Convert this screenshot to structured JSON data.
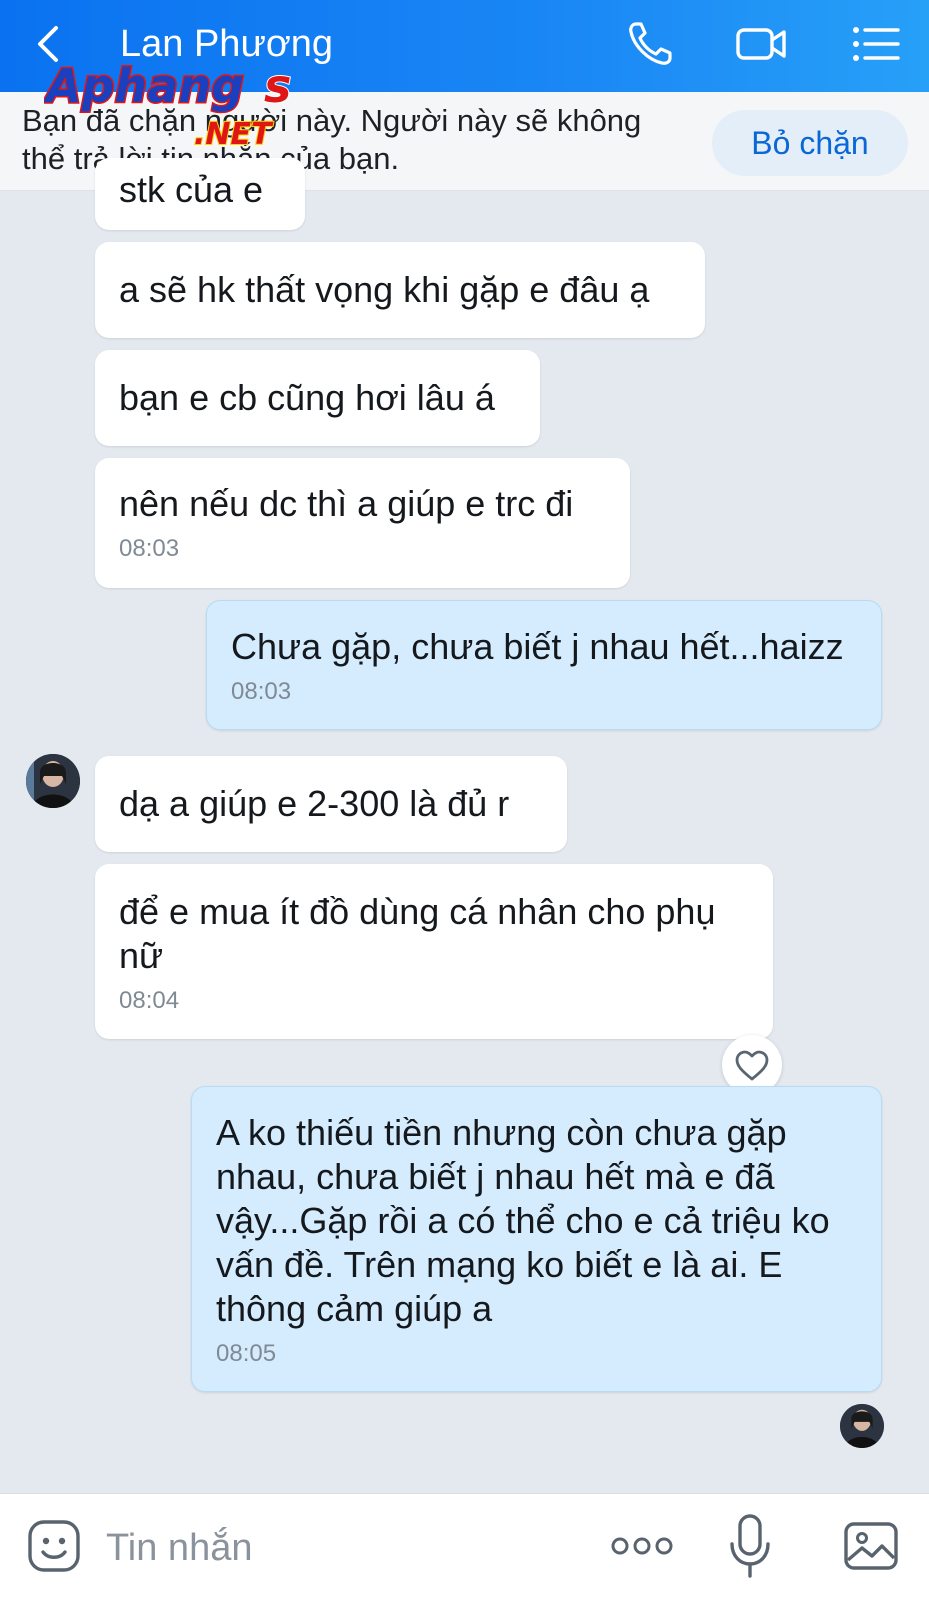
{
  "header": {
    "contact_name": "Lan Phương",
    "icons": [
      "chevron-left-icon",
      "phone-icon",
      "video-camera-icon",
      "list-menu-icon"
    ]
  },
  "watermark": {
    "brand": "Aphangs",
    "suffix": ".NET"
  },
  "blocked_banner": {
    "text": "Bạn đã chặn người này. Người này sẽ không thể trả lời tin nhắn của bạn.",
    "button_label": "Bỏ chặn"
  },
  "messages": [
    {
      "direction": "incoming",
      "text": "stk của e",
      "time": ""
    },
    {
      "direction": "incoming",
      "text": "a sẽ hk thất vọng khi gặp e đâu ạ",
      "time": ""
    },
    {
      "direction": "incoming",
      "text": "bạn e cb cũng hơi lâu á",
      "time": ""
    },
    {
      "direction": "incoming",
      "text": "nên nếu dc thì a giúp e trc đi",
      "time": "08:03"
    },
    {
      "direction": "outgoing",
      "text": "Chưa gặp, chưa biết j nhau hết...haizz",
      "time": "08:03"
    },
    {
      "direction": "incoming",
      "text": "dạ a giúp e 2-300 là đủ r",
      "time": ""
    },
    {
      "direction": "incoming",
      "text": "để e mua ít đồ dùng cá nhân cho phụ nữ",
      "time": "08:04"
    },
    {
      "direction": "outgoing",
      "text": "A ko thiếu tiền nhưng còn chưa gặp nhau, chưa biết j nhau hết mà e đã vậy...Gặp rồi a có thể cho e cả triệu ko vấn đề. Trên mạng ko biết e là ai. E thông cảm giúp a",
      "time": "08:05"
    }
  ],
  "composer": {
    "placeholder": "Tin nhắn",
    "icons": [
      "sticker-icon",
      "more-dots-icon",
      "microphone-icon",
      "image-icon"
    ]
  },
  "colors": {
    "header_gradient_start": "#0a72f0",
    "header_gradient_end": "#27a0f8",
    "chat_background": "#e4e9f0",
    "incoming_bubble": "#ffffff",
    "outgoing_bubble": "#d4ecfd",
    "unblock_text": "#0a67d6"
  }
}
